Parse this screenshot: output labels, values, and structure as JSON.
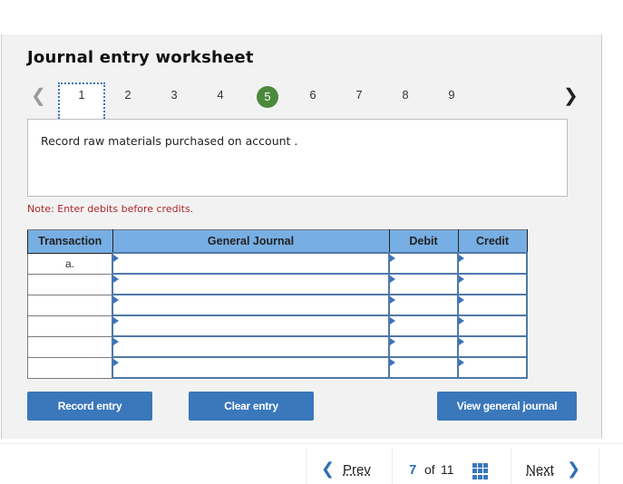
{
  "title": "Journal entry worksheet",
  "steps": [
    "1",
    "2",
    "3",
    "4",
    "5",
    "6",
    "7",
    "8",
    "9"
  ],
  "active_step": "5",
  "focused_step": "1",
  "nav": {
    "prev_icon": "chevron-left-icon",
    "next_icon": "chevron-right-icon"
  },
  "description": "Record raw materials purchased on account .",
  "note": "Note: Enter debits before credits.",
  "table": {
    "headers": [
      "Transaction",
      "General Journal",
      "Debit",
      "Credit"
    ],
    "rows": [
      {
        "transaction": "a.",
        "account": "",
        "debit": "",
        "credit": ""
      },
      {
        "transaction": "",
        "account": "",
        "debit": "",
        "credit": ""
      },
      {
        "transaction": "",
        "account": "",
        "debit": "",
        "credit": ""
      },
      {
        "transaction": "",
        "account": "",
        "debit": "",
        "credit": ""
      },
      {
        "transaction": "",
        "account": "",
        "debit": "",
        "credit": ""
      },
      {
        "transaction": "",
        "account": "",
        "debit": "",
        "credit": ""
      }
    ]
  },
  "buttons": {
    "record": "Record entry",
    "clear": "Clear entry",
    "view": "View general journal"
  },
  "footer": {
    "prev": "Prev",
    "current": "7",
    "of": "of",
    "total": "11",
    "next": "Next"
  },
  "colors": {
    "accent": "#3a77bb",
    "active_step": "#4b8a3c",
    "header_bg": "#77aee3",
    "note": "#b0272a"
  }
}
